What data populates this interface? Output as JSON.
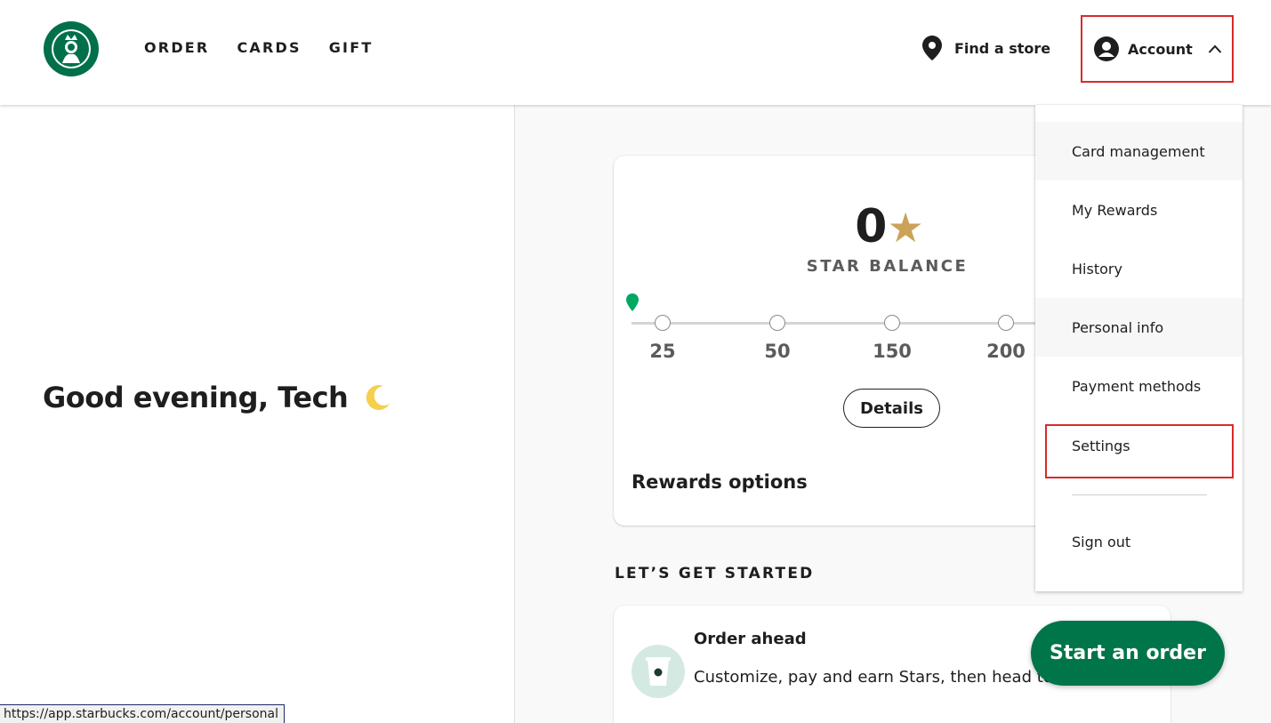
{
  "header": {
    "nav": [
      "ORDER",
      "CARDS",
      "GIFT"
    ],
    "find_store": "Find a store",
    "account": "Account"
  },
  "greeting": {
    "text": "Good evening, Tech",
    "icon": "moon-icon"
  },
  "rewards": {
    "stars": "0",
    "star_icon": "star-icon",
    "balance_label": "STAR BALANCE",
    "progress_fraction": 0,
    "ticks": [
      "25",
      "50",
      "150",
      "200"
    ],
    "details_label": "Details",
    "options_title": "Rewards options"
  },
  "get_started": {
    "title": "LET’S GET STARTED",
    "order_title": "Order ahead",
    "order_desc": "Customize, pay and earn Stars, then head to pickup"
  },
  "dropdown": {
    "items": [
      "Card management",
      "My Rewards",
      "History",
      "Personal info",
      "Payment methods",
      "Settings"
    ],
    "sign_out": "Sign out"
  },
  "start_order": "Start an order",
  "status_url": "https://app.starbucks.com/account/personal",
  "colors": {
    "brand_green": "#00754a",
    "star_gold": "#cba258",
    "highlight_red": "#d62b2b"
  }
}
